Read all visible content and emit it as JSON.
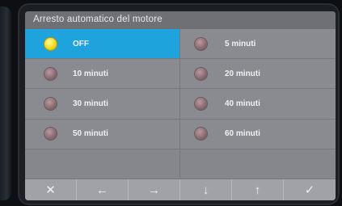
{
  "screen": {
    "title": "Arresto automatico del motore"
  },
  "options": [
    {
      "label": "OFF",
      "selected": true
    },
    {
      "label": "5 minuti",
      "selected": false
    },
    {
      "label": "10 minuti",
      "selected": false
    },
    {
      "label": "20 minuti",
      "selected": false
    },
    {
      "label": "30 minuti",
      "selected": false
    },
    {
      "label": "40 minuti",
      "selected": false
    },
    {
      "label": "50 minuti",
      "selected": false
    },
    {
      "label": "60 minuti",
      "selected": false
    }
  ],
  "toolbar": {
    "close_glyph": "✕",
    "left_glyph": "←",
    "right_glyph": "→",
    "down_glyph": "↓",
    "up_glyph": "↑",
    "confirm_glyph": "✓"
  },
  "colors": {
    "selected_row": "#1fa3dc",
    "radio_on": "#f1dc1c",
    "radio_off": "#8b6c72"
  }
}
